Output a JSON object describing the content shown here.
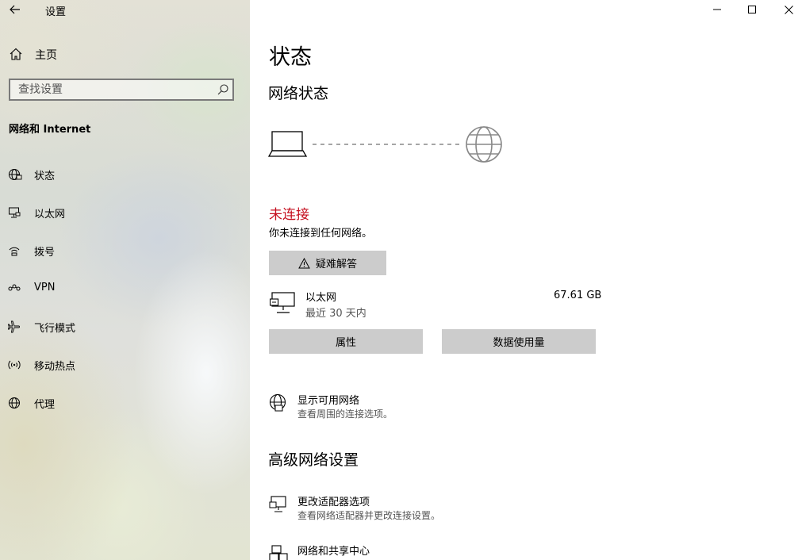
{
  "window": {
    "title": "设置",
    "controls": [
      "minimize",
      "maximize",
      "close"
    ]
  },
  "sidebar": {
    "home_label": "主页",
    "search_placeholder": "查找设置",
    "section_title": "网络和 Internet",
    "items": [
      {
        "label": "状态",
        "icon": "status-globe-icon"
      },
      {
        "label": "以太网",
        "icon": "ethernet-icon"
      },
      {
        "label": "拨号",
        "icon": "dialup-icon"
      },
      {
        "label": "VPN",
        "icon": "vpn-icon"
      },
      {
        "label": "飞行模式",
        "icon": "airplane-icon"
      },
      {
        "label": "移动热点",
        "icon": "hotspot-icon"
      },
      {
        "label": "代理",
        "icon": "proxy-globe-icon"
      }
    ]
  },
  "main": {
    "page_title": "状态",
    "network_status_heading": "网络状态",
    "status_text": "未连接",
    "status_desc": "你未连接到任何网络。",
    "troubleshoot_label": "疑难解答",
    "connection": {
      "name": "以太网",
      "period": "最近 30 天内",
      "usage": "67.61 GB"
    },
    "properties_label": "属性",
    "data_usage_label": "数据使用量",
    "show_networks": {
      "title": "显示可用网络",
      "subtitle": "查看周围的连接选项。"
    },
    "advanced_heading": "高级网络设置",
    "adapter_options": {
      "title": "更改适配器选项",
      "subtitle": "查看网络适配器并更改连接设置。"
    },
    "sharing_center": {
      "title": "网络和共享中心"
    }
  },
  "colors": {
    "error_red": "#c50f1f",
    "button_gray": "#cccccc",
    "secondary_text": "#555555"
  }
}
